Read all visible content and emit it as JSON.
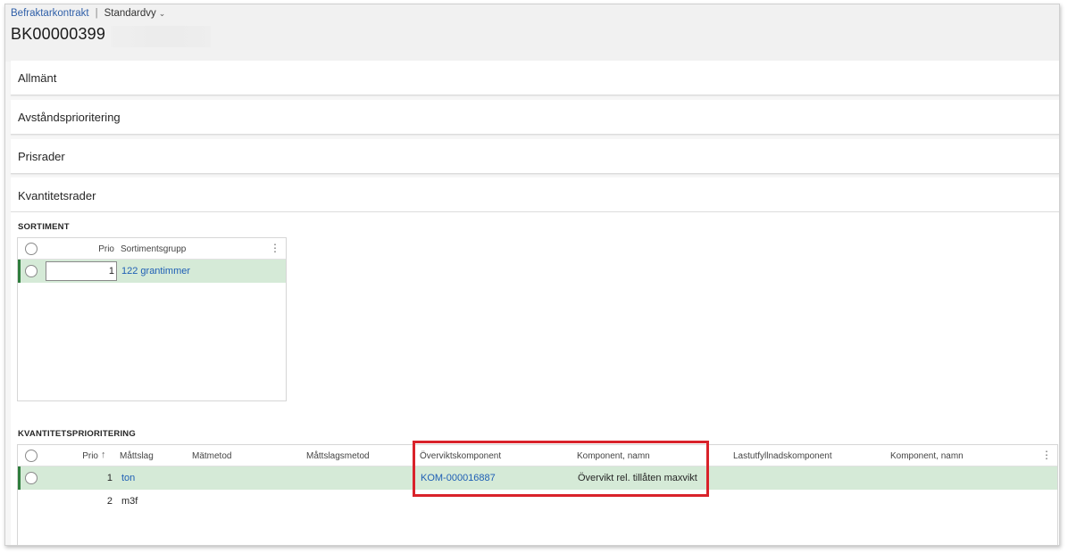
{
  "breadcrumb": {
    "module": "Befraktarkontrakt",
    "separator": "|",
    "view": "Standardvy"
  },
  "record_id": "BK00000399",
  "fasttabs": [
    "Allmänt",
    "Avståndsprioritering",
    "Prisrader"
  ],
  "quantity_section": {
    "title": "Kvantitetsrader",
    "assortment": {
      "label": "SORTIMENT",
      "columns": {
        "prio": "Prio",
        "group": "Sortimentsgrupp"
      },
      "rows": [
        {
          "prio": "1",
          "group": "122 grantimmer"
        }
      ]
    },
    "priority": {
      "label": "KVANTITETSPRIORITERING",
      "columns": {
        "prio": "Prio",
        "sort_arrow": "↑",
        "unit_type": "Måttslag",
        "method": "Mätmetod",
        "unit_type_method": "Måttslagsmetod",
        "overweight_component": "Överviktskomponent",
        "component_name": "Komponent, namn",
        "load_fill_component": "Lastutfyllnadskomponent",
        "component_name_2": "Komponent, namn"
      },
      "rows": [
        {
          "prio": "1",
          "unit_type": "ton",
          "overweight_component": "KOM-000016887",
          "component_name": "Övervikt rel. tillåten maxvikt"
        },
        {
          "prio": "2",
          "unit_type": "m3f",
          "overweight_component": "",
          "component_name": ""
        }
      ]
    }
  },
  "colors": {
    "accent_link": "#1f5fb5",
    "selected_row": "#d5ead7",
    "selection_marker": "#2f7d3d",
    "highlight_box": "#d9222a"
  },
  "icons": {
    "view_dropdown": "chevron-down-icon",
    "grid_menu": "more-vertical-icon",
    "row_select": "radio-circle-icon",
    "sort": "sort-ascending-icon"
  }
}
